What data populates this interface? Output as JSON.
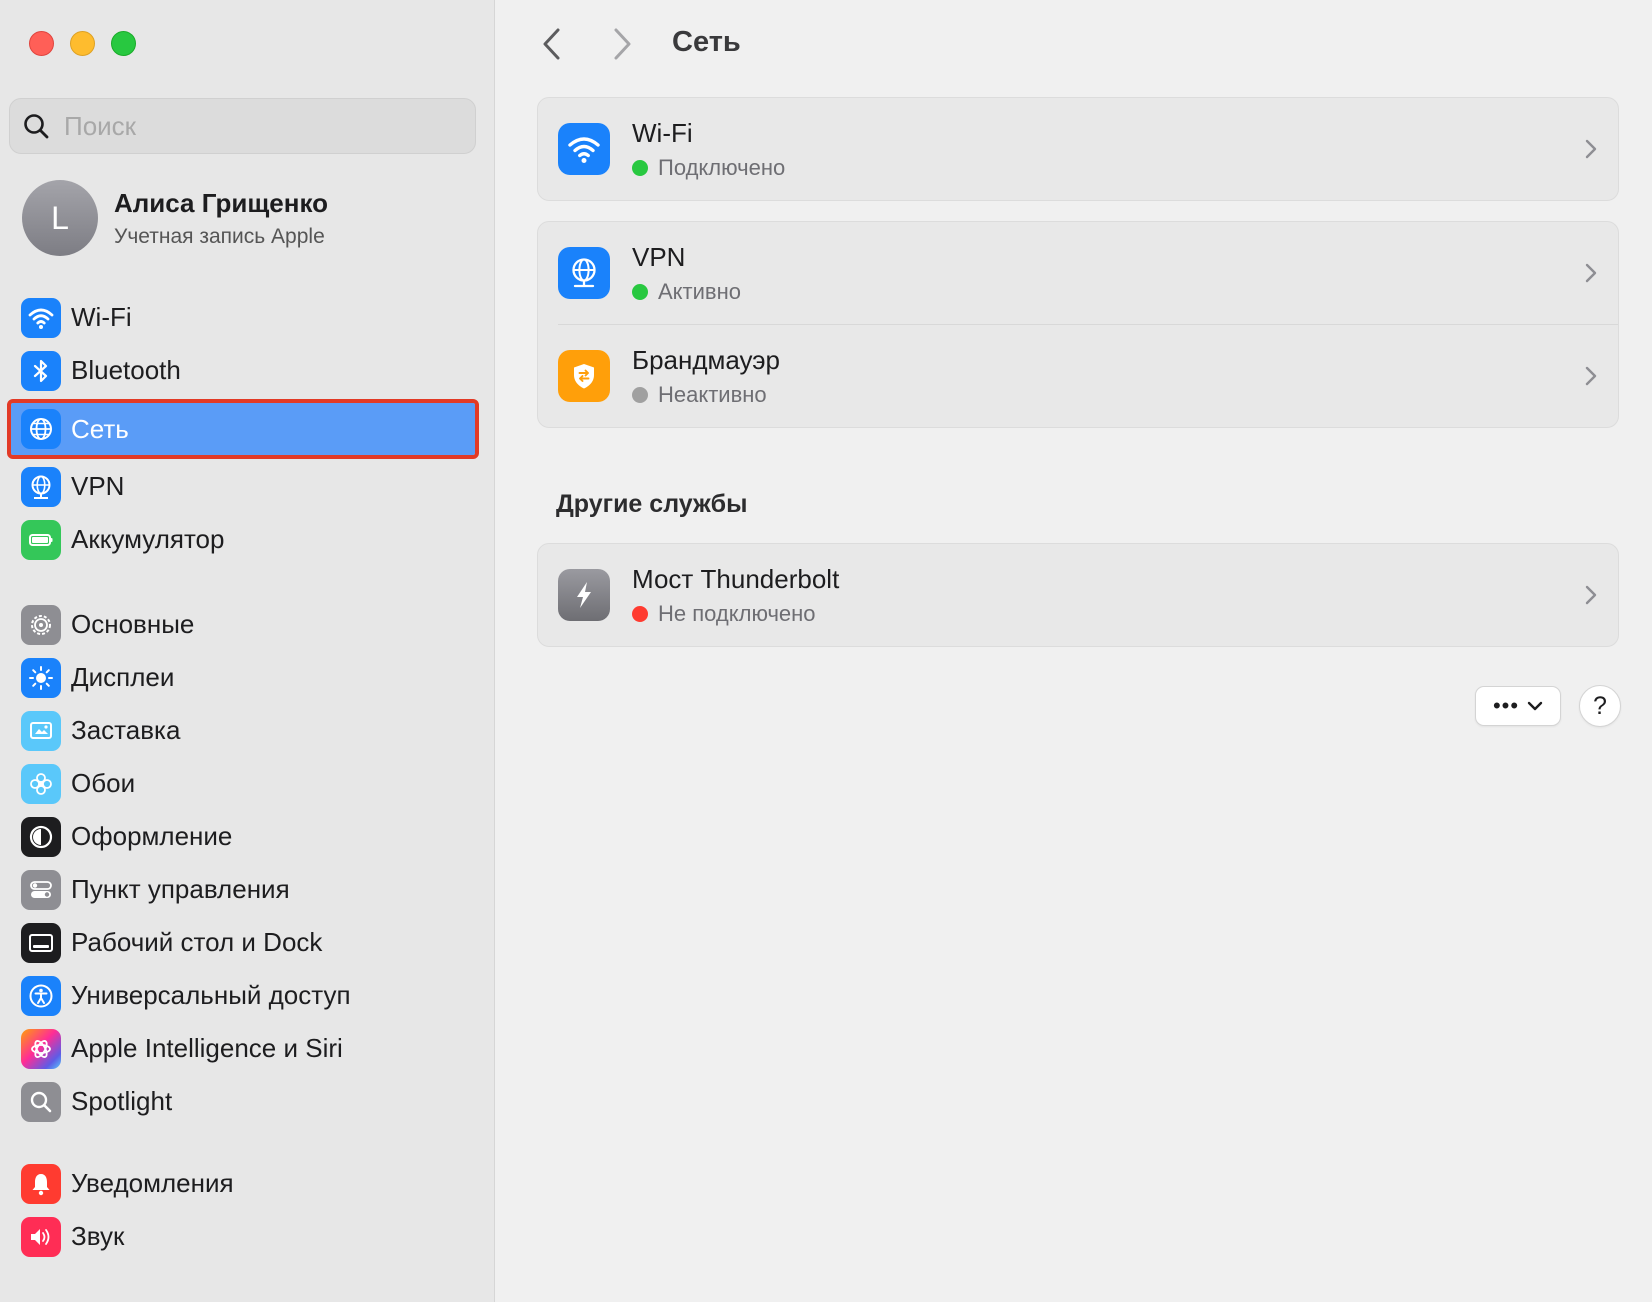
{
  "sidebar": {
    "search_placeholder": "Поиск",
    "account": {
      "avatar_letter": "L",
      "name": "Алиса Грищенко",
      "subtitle": "Учетная запись Apple"
    },
    "items": [
      {
        "label": "Wi-Fi",
        "icon": "wifi-icon",
        "color": "#1a82fb"
      },
      {
        "label": "Bluetooth",
        "icon": "bluetooth-icon",
        "color": "#1a82fb"
      },
      {
        "label": "Сеть",
        "icon": "globe-icon",
        "color": "#1a82fb",
        "selected": true
      },
      {
        "label": "VPN",
        "icon": "vpn-globe-icon",
        "color": "#1a82fb"
      },
      {
        "label": "Аккумулятор",
        "icon": "battery-icon",
        "color": "#34c759"
      },
      {
        "label": "Основные",
        "icon": "gear-icon",
        "color": "#8e8e93"
      },
      {
        "label": "Дисплеи",
        "icon": "sun-icon",
        "color": "#1a82fb"
      },
      {
        "label": "Заставка",
        "icon": "screensaver-icon",
        "color": "#5ac8fa"
      },
      {
        "label": "Обои",
        "icon": "flower-icon",
        "color": "#5ac8fa"
      },
      {
        "label": "Оформление",
        "icon": "appearance-icon",
        "color": "#1d1d1f"
      },
      {
        "label": "Пункт управления",
        "icon": "control-center-icon",
        "color": "#8e8e93"
      },
      {
        "label": "Рабочий стол и Dock",
        "icon": "dock-icon",
        "color": "#1d1d1f"
      },
      {
        "label": "Универсальный доступ",
        "icon": "accessibility-icon",
        "color": "#1a82fb"
      },
      {
        "label": "Apple Intelligence и Siri",
        "icon": "siri-icon",
        "color": "#ff6fb1"
      },
      {
        "label": "Spotlight",
        "icon": "magnifier-icon",
        "color": "#8e8e93"
      },
      {
        "label": "Уведомления",
        "icon": "bell-icon",
        "color": "#ff3b30"
      },
      {
        "label": "Звук",
        "icon": "speaker-icon",
        "color": "#ff2d55"
      }
    ]
  },
  "main": {
    "title": "Сеть",
    "services": [
      {
        "title": "Wi-Fi",
        "status": "Подключено",
        "status_color": "#28c840",
        "icon": "wifi-icon",
        "icon_color": "#1a82fb"
      },
      {
        "title": "VPN",
        "status": "Активно",
        "status_color": "#28c840",
        "icon": "vpn-globe-icon",
        "icon_color": "#1a82fb"
      },
      {
        "title": "Брандмауэр",
        "status": "Неактивно",
        "status_color": "#a0a0a0",
        "icon": "firewall-shield-icon",
        "icon_color": "#ff9f0a"
      }
    ],
    "other_title": "Другие службы",
    "other": [
      {
        "title": "Мост Thunderbolt",
        "status": "Не подключено",
        "status_color": "#ff3b30",
        "icon": "thunderbolt-icon",
        "icon_color": "#8e8e93"
      }
    ],
    "more_label": "•••",
    "help_label": "?"
  }
}
